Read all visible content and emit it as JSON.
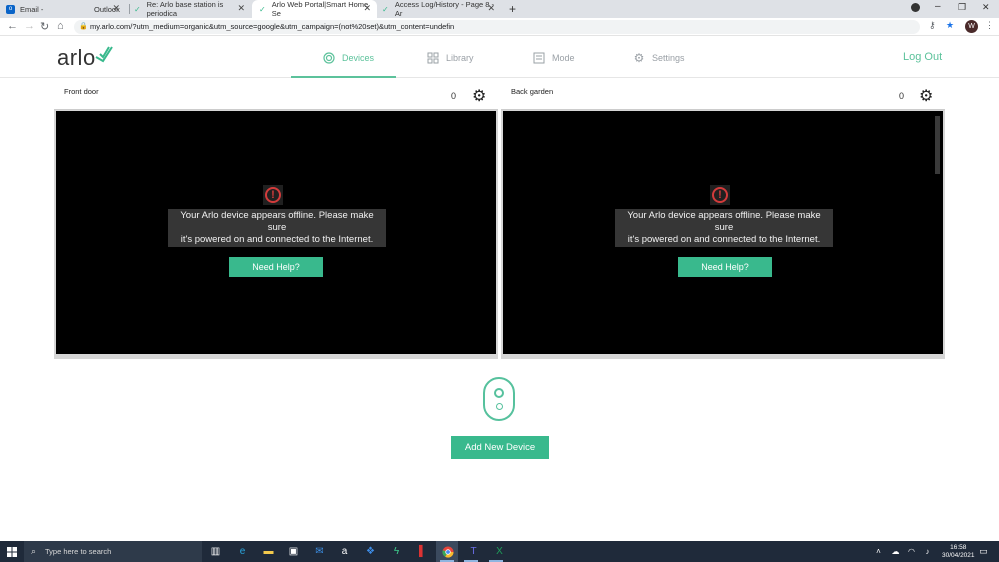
{
  "browser": {
    "tabs": [
      {
        "label": "Email -",
        "label_suffix": "Outlook",
        "icon": "outlook-icon"
      },
      {
        "label": "Re: Arlo base station is periodica",
        "icon": "arlo-icon"
      },
      {
        "label": "Arlo Web Portal|Smart Home Se",
        "icon": "arlo-icon"
      },
      {
        "label": "Access Log/History - Page 8 - Ar",
        "icon": "arlo-icon"
      }
    ],
    "new_tab_symbol": "+",
    "url": "my.arlo.com/?utm_medium=organic&utm_source=google&utm_campaign=(not%20set)&utm_content=undefin",
    "profile_initial": "W"
  },
  "app": {
    "logo": "arlo",
    "nav": [
      {
        "label": "Devices",
        "icon": "devices-icon",
        "active": true
      },
      {
        "label": "Library",
        "icon": "library-icon",
        "active": false
      },
      {
        "label": "Mode",
        "icon": "mode-icon",
        "active": false
      },
      {
        "label": "Settings",
        "icon": "settings-icon",
        "active": false
      }
    ],
    "logout_label": "Log Out",
    "accent_color": "#5cc29b"
  },
  "cameras": [
    {
      "name": "Front door",
      "count": "0",
      "message_line1": "Your Arlo device appears offline. Please make sure",
      "message_line2": "it's powered on and connected to the Internet.",
      "help_label": "Need Help?"
    },
    {
      "name": "Back garden",
      "count": "0",
      "message_line1": "Your Arlo device appears offline. Please make sure",
      "message_line2": "it's powered on and connected to the Internet.",
      "help_label": "Need Help?"
    }
  ],
  "add_device_label": "Add New Device",
  "taskbar": {
    "search_placeholder": "Type here to search",
    "time": "16:58",
    "date": "30/04/2021"
  }
}
